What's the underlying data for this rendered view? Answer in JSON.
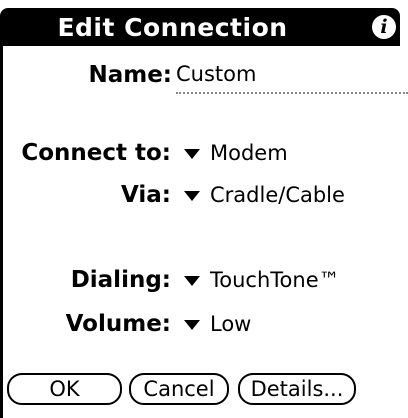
{
  "header": {
    "title": "Edit Connection",
    "info_icon": "info-icon",
    "info_glyph": "i"
  },
  "form": {
    "name_label": "Name:",
    "name_value": "Custom",
    "connect_to_label": "Connect to:",
    "connect_to_value": "Modem",
    "via_label": "Via:",
    "via_value": "Cradle/Cable",
    "dialing_label": "Dialing:",
    "dialing_value": "TouchTone™",
    "volume_label": "Volume:",
    "volume_value": "Low"
  },
  "buttons": {
    "ok": "OK",
    "cancel": "Cancel",
    "details": "Details..."
  },
  "colors": {
    "titlebar": "#000000",
    "background": "#ffffff"
  }
}
